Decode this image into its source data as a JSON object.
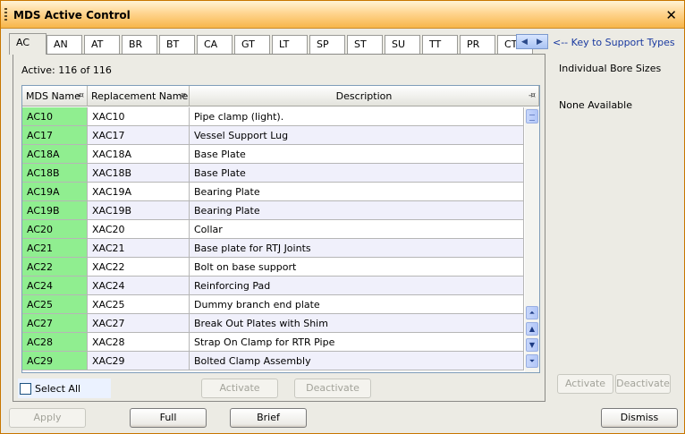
{
  "window": {
    "title": "MDS Active Control"
  },
  "tabs": [
    "AC",
    "AN",
    "AT",
    "BR",
    "BT",
    "CA",
    "GT",
    "LT",
    "SP",
    "ST",
    "SU",
    "TT",
    "PR",
    "CT"
  ],
  "key_link": "<-- Key to Support Types",
  "active_count": "Active: 116 of 116",
  "grid": {
    "columns": [
      "MDS Name",
      "Replacement Name",
      "Description"
    ],
    "rows": [
      [
        "AC10",
        "XAC10",
        "Pipe clamp (light)."
      ],
      [
        "AC17",
        "XAC17",
        "Vessel Support Lug"
      ],
      [
        "AC18A",
        "XAC18A",
        "Base Plate"
      ],
      [
        "AC18B",
        "XAC18B",
        "Base Plate"
      ],
      [
        "AC19A",
        "XAC19A",
        "Bearing Plate"
      ],
      [
        "AC19B",
        "XAC19B",
        "Bearing Plate"
      ],
      [
        "AC20",
        "XAC20",
        "Collar"
      ],
      [
        "AC21",
        "XAC21",
        "Base plate for RTJ Joints"
      ],
      [
        "AC22",
        "XAC22",
        "Bolt on base support"
      ],
      [
        "AC24",
        "XAC24",
        "Reinforcing Pad"
      ],
      [
        "AC25",
        "XAC25",
        "Dummy branch end plate"
      ],
      [
        "AC27",
        "XAC27",
        "Break Out Plates with Shim"
      ],
      [
        "AC28",
        "XAC28",
        "Strap On Clamp for RTR Pipe"
      ],
      [
        "AC29",
        "XAC29",
        "Bolted Clamp Assembly"
      ]
    ]
  },
  "select_all_label": "Select All",
  "panel_buttons": {
    "activate": "Activate",
    "deactivate": "Deactivate"
  },
  "right_panel": {
    "title": "Individual Bore Sizes",
    "empty_text": "None Available",
    "activate": "Activate",
    "deactivate": "Deactivate"
  },
  "footer": {
    "apply": "Apply",
    "full": "Full",
    "brief": "Brief",
    "dismiss": "Dismiss"
  },
  "colors": {
    "title_bar": "#f7b64a",
    "mds_cell": "#90ee90",
    "link": "#1a3aa0",
    "select_all_bg": "#ebf2ff"
  },
  "icons": [
    "grip-icon",
    "close-icon",
    "pin-icon",
    "chevron-left-icon",
    "chevron-right-icon",
    "scroll-up-icon",
    "scroll-down-icon"
  ]
}
